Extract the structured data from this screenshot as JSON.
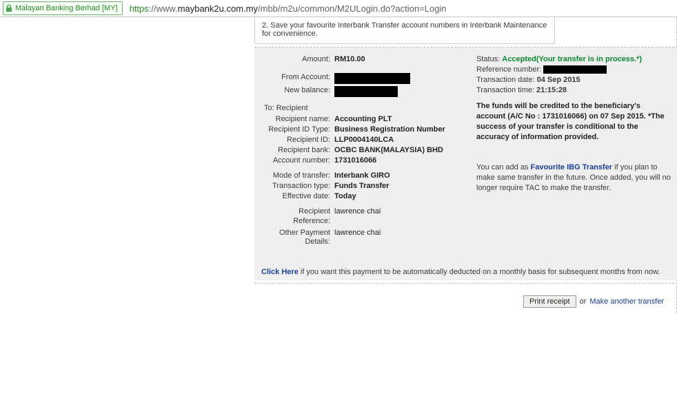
{
  "browser": {
    "ssl_label": "Malayan Banking Berhad [MY]",
    "url_scheme": "https",
    "url_host": "://www.",
    "url_domain": "maybank2u.com.my",
    "url_rest": "/mbb/m2u/common/M2ULogin.do?action=Login"
  },
  "tip": {
    "prefix": "2.",
    "text": "Save your favourite Interbank Transfer account numbers in Interbank Maintenance for convenience."
  },
  "left": {
    "amount_label": "Amount:",
    "amount_value": "RM10.00",
    "from_label": "From Account:",
    "newbal_label": "New balance:",
    "to_header": "To: Recipient",
    "rname_label": "Recipient name:",
    "rname_value": "Accounting PLT",
    "idtype_label": "Recipient ID Type:",
    "idtype_value": "Business Registration Number",
    "rid_label": "Recipient ID:",
    "rid_value": "LLP0004140LCA",
    "rbank_label": "Recipient bank:",
    "rbank_value": "OCBC BANK(MALAYSIA) BHD",
    "acct_label": "Account number:",
    "acct_value": "1731016066",
    "mode_label": "Mode of transfer:",
    "mode_value": "Interbank GIRO",
    "ttype_label": "Transaction type:",
    "ttype_value": "Funds Transfer",
    "eff_label": "Effective date:",
    "eff_value": "Today",
    "rref_label": "Recipient Reference:",
    "rref_value": "lawrence chai",
    "opd_label": "Other Payment Details:",
    "opd_value": "lawrence chai"
  },
  "right": {
    "status_label": "Status: ",
    "status_value": "Accepted(Your transfer is in process.*)",
    "ref_label": "Reference number: ",
    "date_label": "Transaction date: ",
    "date_value": "04 Sep 2015",
    "time_label": "Transaction time: ",
    "time_value": "21:15:28",
    "note_text": "The funds will be credited to the beneficiary's account (A/C No : 1731016066) on 07 Sep 2015. *The success of your transfer is conditional to the accuracy of information provided.",
    "fav_pre": "You can add as ",
    "fav_link": "Favourite IBG Transfer",
    "fav_post": " if you plan to make same transfer in the future. Once added, you will no longer require TAC to make the transfer."
  },
  "footer_line": {
    "link": "Click Here",
    "rest": " if you want this payment to be automatically deducted on a monthly basis for subsequent months from now."
  },
  "actions": {
    "print": "Print receipt",
    "or": "or",
    "another": "Make another transfer"
  }
}
